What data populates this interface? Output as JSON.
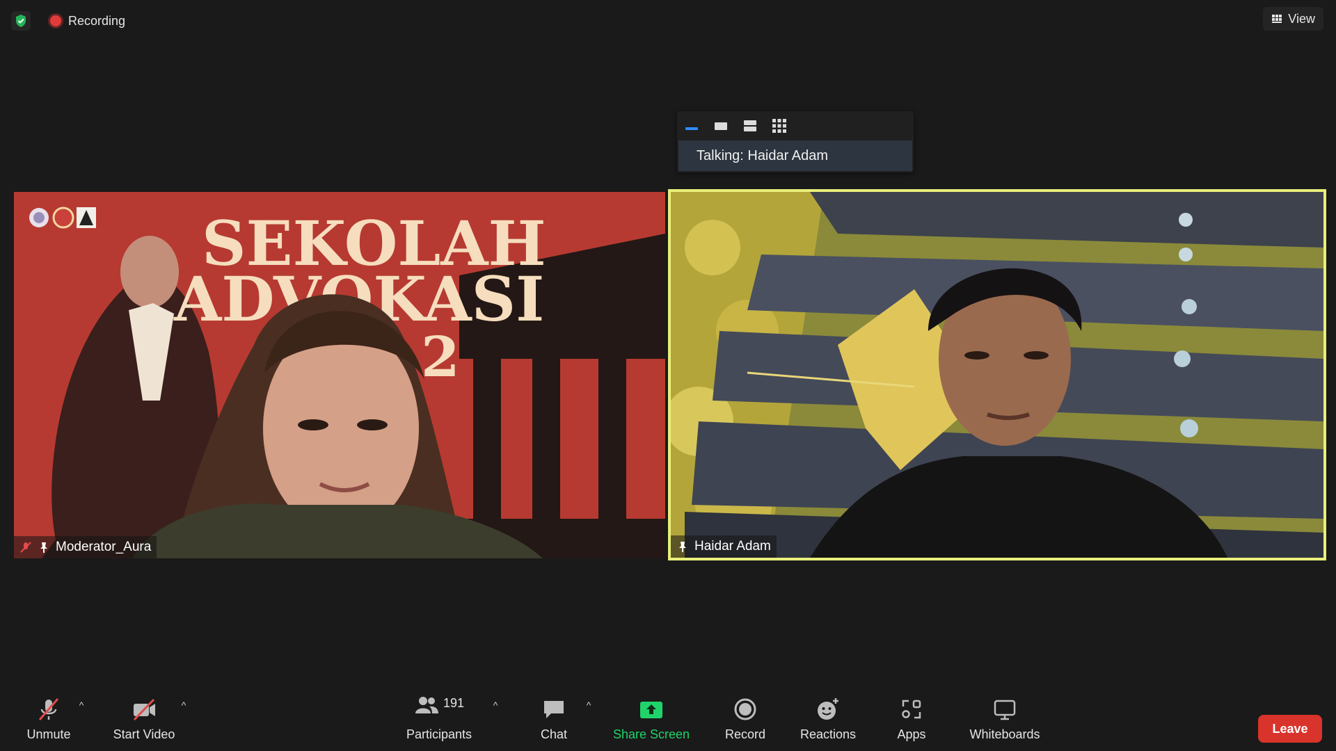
{
  "top_bar": {
    "security_icon": "shield-check-icon",
    "recording_label": "Recording",
    "view_label": "View"
  },
  "talking_panel": {
    "layout_icons": [
      "minimize-icon",
      "single-view-icon",
      "split-view-icon",
      "grid-view-icon"
    ],
    "text": "Talking: Haidar Adam"
  },
  "tiles": [
    {
      "name": "Moderator_Aura",
      "muted": true,
      "background_text_line1": "SEKOLAH",
      "background_text_line2": "ADVOKASI",
      "background_text_line3": "2"
    },
    {
      "name": "Haidar Adam",
      "active_speaker": true,
      "highlight_color": "#e9ef7a"
    }
  ],
  "toolbar": {
    "unmute_label": "Unmute",
    "start_video_label": "Start Video",
    "participants_label": "Participants",
    "participants_count": "191",
    "chat_label": "Chat",
    "share_screen_label": "Share Screen",
    "record_label": "Record",
    "reactions_label": "Reactions",
    "apps_label": "Apps",
    "whiteboards_label": "Whiteboards",
    "leave_label": "Leave"
  },
  "colors": {
    "background": "#1a1a1a",
    "share_green": "#1fd36a",
    "leave_red": "#d9342b",
    "recording_red": "#e23b3b",
    "active_border": "#e9ef7a"
  }
}
